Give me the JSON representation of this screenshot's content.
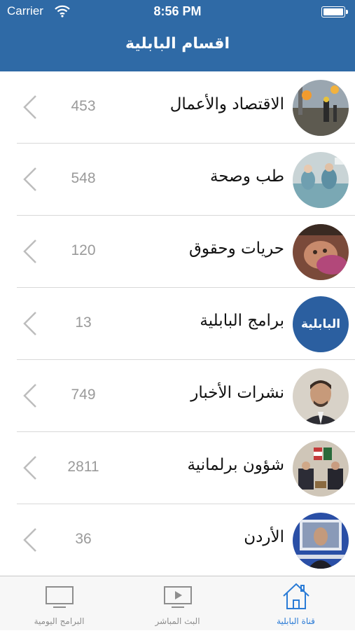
{
  "status_bar": {
    "carrier": "Carrier",
    "time": "8:56 PM"
  },
  "header": {
    "title": "اقسام البابلية"
  },
  "categories": [
    {
      "label": "الاقتصاد والأعمال",
      "count": "453",
      "thumbnail": "oil-workers-photo"
    },
    {
      "label": "طب وصحة",
      "count": "548",
      "thumbnail": "surgery-photo"
    },
    {
      "label": "حريات وحقوق",
      "count": "120",
      "thumbnail": "injured-child-photo"
    },
    {
      "label": "برامج البابلية",
      "count": "13",
      "thumbnail": "albabiliya-logo",
      "logo_text": "البابلية"
    },
    {
      "label": "نشرات الأخبار",
      "count": "749",
      "thumbnail": "news-anchor-photo"
    },
    {
      "label": "شؤون برلمانية",
      "count": "2811",
      "thumbnail": "parliament-meeting-photo"
    },
    {
      "label": "الأردن",
      "count": "36",
      "thumbnail": "jordan-photo"
    }
  ],
  "tab_bar": {
    "tabs": [
      {
        "label": "البرامج اليومية",
        "icon": "tv-icon",
        "active": false
      },
      {
        "label": "البث المباشر",
        "icon": "play-screen-icon",
        "active": false
      },
      {
        "label": "قناة البابلية",
        "icon": "home-icon",
        "active": true
      }
    ],
    "active_color": "#2a7bd6",
    "inactive_color": "#8e8e8e"
  },
  "colors": {
    "header": "#2f6aa6",
    "logo_bg": "#2b5fa0"
  }
}
